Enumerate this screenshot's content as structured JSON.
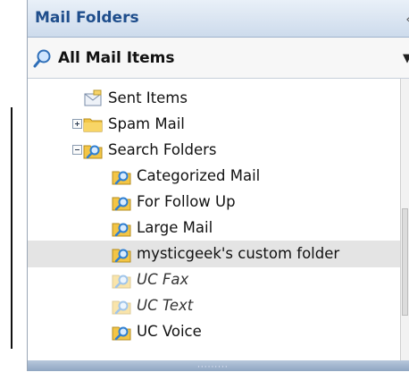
{
  "panel": {
    "title": "Mail Folders"
  },
  "all_mail": {
    "label": "All Mail Items"
  },
  "folders": [
    {
      "label": "Sent Items",
      "icon": "sent-folder-icon",
      "expander": "none",
      "style": "normal",
      "selected": false
    },
    {
      "label": "Spam Mail",
      "icon": "folder-icon",
      "expander": "plus",
      "style": "normal",
      "selected": false
    },
    {
      "label": "Search Folders",
      "icon": "search-folder-icon",
      "expander": "minus",
      "style": "normal",
      "selected": false
    },
    {
      "label": "Categorized Mail",
      "icon": "search-folder-icon",
      "expander": "none",
      "style": "normal",
      "selected": false
    },
    {
      "label": "For Follow Up",
      "icon": "search-folder-icon",
      "expander": "none",
      "style": "normal",
      "selected": false
    },
    {
      "label": "Large Mail",
      "icon": "search-folder-icon",
      "expander": "none",
      "style": "normal",
      "selected": false
    },
    {
      "label": "mysticgeek's custom folder",
      "icon": "search-folder-icon",
      "expander": "none",
      "style": "normal",
      "selected": true
    },
    {
      "label": "UC Fax",
      "icon": "search-folder-disabled-icon",
      "expander": "none",
      "style": "italic",
      "selected": false
    },
    {
      "label": "UC Text",
      "icon": "search-folder-disabled-icon",
      "expander": "none",
      "style": "italic",
      "selected": false
    },
    {
      "label": "UC Voice",
      "icon": "search-folder-icon",
      "expander": "none",
      "style": "normal",
      "selected": false
    }
  ],
  "colors": {
    "title": "#1f4e8c",
    "selected_row": "#e4e4e4",
    "folder_yellow": "#f3c545",
    "search_blue": "#2f7fd1"
  }
}
